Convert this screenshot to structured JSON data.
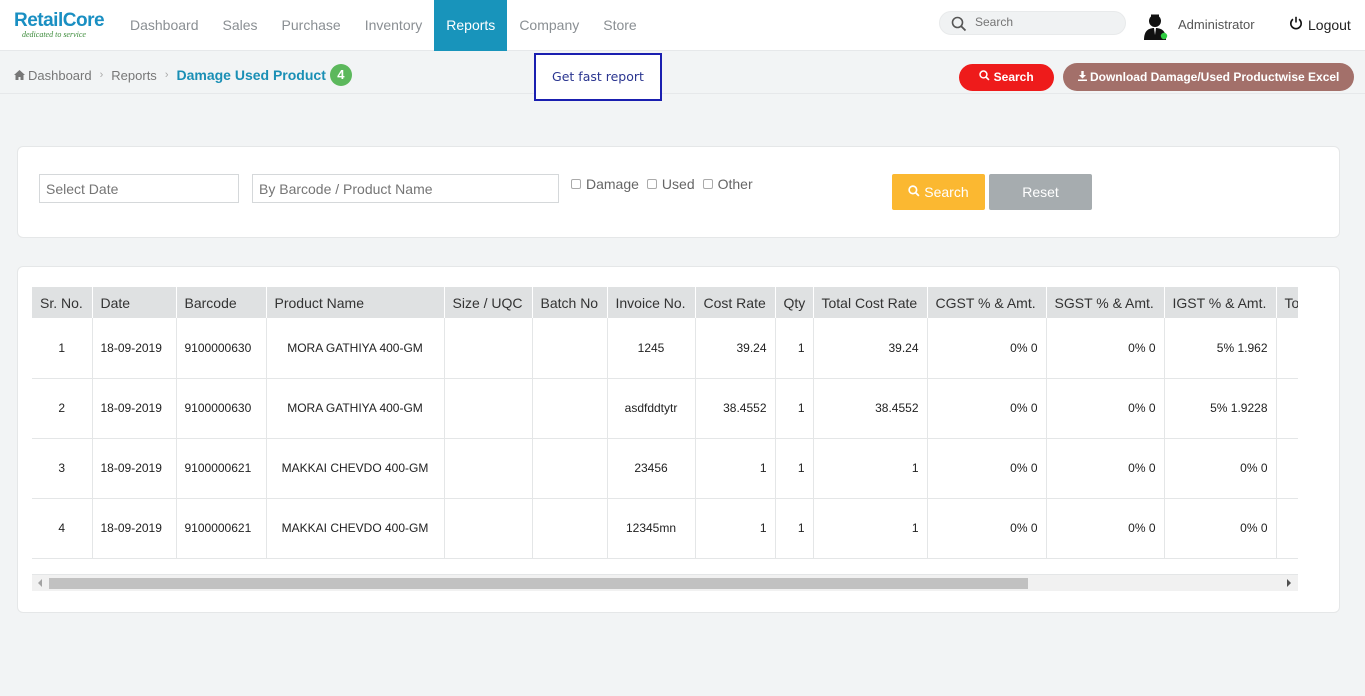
{
  "app": {
    "logo_main": "RetailCore",
    "logo_sub": "dedicated to service",
    "accent_color": "#1894bb"
  },
  "nav": {
    "items": [
      {
        "label": "Dashboard",
        "active": false
      },
      {
        "label": "Sales",
        "active": false
      },
      {
        "label": "Purchase",
        "active": false
      },
      {
        "label": "Inventory",
        "active": false
      },
      {
        "label": "Reports",
        "active": true
      },
      {
        "label": "Company",
        "active": false
      },
      {
        "label": "Store",
        "active": false
      }
    ],
    "search_placeholder": "Search",
    "user_name": "Administrator",
    "logout_label": "Logout"
  },
  "breadcrumb": {
    "home": "Dashboard",
    "section": "Reports",
    "current": "Damage Used Product",
    "count": "4"
  },
  "header": {
    "fast_report": "Get fast report",
    "search_label": "Search",
    "download_label": "Download Damage/Used Productwise Excel"
  },
  "filters": {
    "date_placeholder": "Select Date",
    "product_placeholder": "By Barcode / Product Name",
    "checkboxes": [
      "Damage",
      "Used",
      "Other"
    ],
    "search_label": "Search",
    "reset_label": "Reset"
  },
  "table": {
    "columns": [
      "Sr. No.",
      "Date",
      "Barcode",
      "Product Name",
      "Size / UQC",
      "Batch No",
      "Invoice No.",
      "Cost Rate",
      "Qty",
      "Total Cost Rate",
      "CGST % & Amt.",
      "SGST % & Amt.",
      "IGST % & Amt.",
      "To"
    ],
    "rows": [
      [
        "1",
        "18-09-2019",
        "9100000630",
        "MORA GATHIYA 400-GM",
        "",
        "",
        "1245",
        "39.24",
        "1",
        "39.24",
        "0% 0",
        "0% 0",
        "5% 1.962",
        ""
      ],
      [
        "2",
        "18-09-2019",
        "9100000630",
        "MORA GATHIYA 400-GM",
        "",
        "",
        "asdfddtytr",
        "38.4552",
        "1",
        "38.4552",
        "0% 0",
        "0% 0",
        "5% 1.9228",
        ""
      ],
      [
        "3",
        "18-09-2019",
        "9100000621",
        "MAKKAI CHEVDO 400-GM",
        "",
        "",
        "23456",
        "1",
        "1",
        "1",
        "0% 0",
        "0% 0",
        "0% 0",
        ""
      ],
      [
        "4",
        "18-09-2019",
        "9100000621",
        "MAKKAI CHEVDO 400-GM",
        "",
        "",
        "12345mn",
        "1",
        "1",
        "1",
        "0% 0",
        "0% 0",
        "0% 0",
        ""
      ]
    ]
  }
}
